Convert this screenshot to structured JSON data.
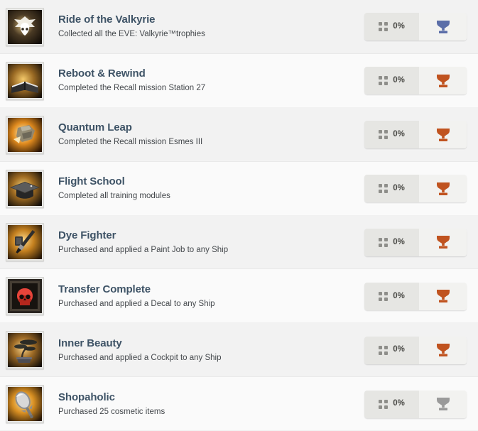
{
  "list": {
    "name": "achievements-list",
    "rows": [
      {
        "title": "Ride of the Valkyrie",
        "description": "Collected all the EVE: Valkyrie™trophies",
        "progress": "0%",
        "trophy_color": "#5b6ea8",
        "trophy_tier": "platinum",
        "icon_name": "valkyrie-winged-skull-icon"
      },
      {
        "title": "Reboot & Rewind",
        "description": "Completed the Recall mission Station 27",
        "progress": "0%",
        "trophy_color": "#c0531f",
        "trophy_tier": "bronze",
        "icon_name": "open-book-icon"
      },
      {
        "title": "Quantum Leap",
        "description": "Completed the Recall mission Esmes III",
        "progress": "0%",
        "trophy_color": "#c0531f",
        "trophy_tier": "bronze",
        "icon_name": "explosion-wreck-icon"
      },
      {
        "title": "Flight School",
        "description": "Completed all training modules",
        "progress": "0%",
        "trophy_color": "#c0531f",
        "trophy_tier": "bronze",
        "icon_name": "graduation-cap-icon"
      },
      {
        "title": "Dye Fighter",
        "description": "Purchased and applied a Paint Job to any Ship",
        "progress": "0%",
        "trophy_color": "#c0531f",
        "trophy_tier": "bronze",
        "icon_name": "paint-brush-icon"
      },
      {
        "title": "Transfer Complete",
        "description": "Purchased and applied a Decal to any Ship",
        "progress": "0%",
        "trophy_color": "#c0531f",
        "trophy_tier": "bronze",
        "icon_name": "red-skull-decal-icon"
      },
      {
        "title": "Inner Beauty",
        "description": "Purchased and applied a Cockpit to any Ship",
        "progress": "0%",
        "trophy_color": "#c0531f",
        "trophy_tier": "bronze",
        "icon_name": "bonsai-tree-icon"
      },
      {
        "title": "Shopaholic",
        "description": "Purchased 25 cosmetic items",
        "progress": "0%",
        "trophy_color": "#9a9a9a",
        "trophy_tier": "silver",
        "icon_name": "hand-mirror-icon"
      }
    ]
  },
  "colors": {
    "row_odd_bg": "#f2f2f2",
    "row_even_bg": "#fafafa",
    "title": "#3e5366",
    "description": "#44484c",
    "progress_bg": "#e6e6e3",
    "trophy_bg": "#f2f2f0"
  }
}
